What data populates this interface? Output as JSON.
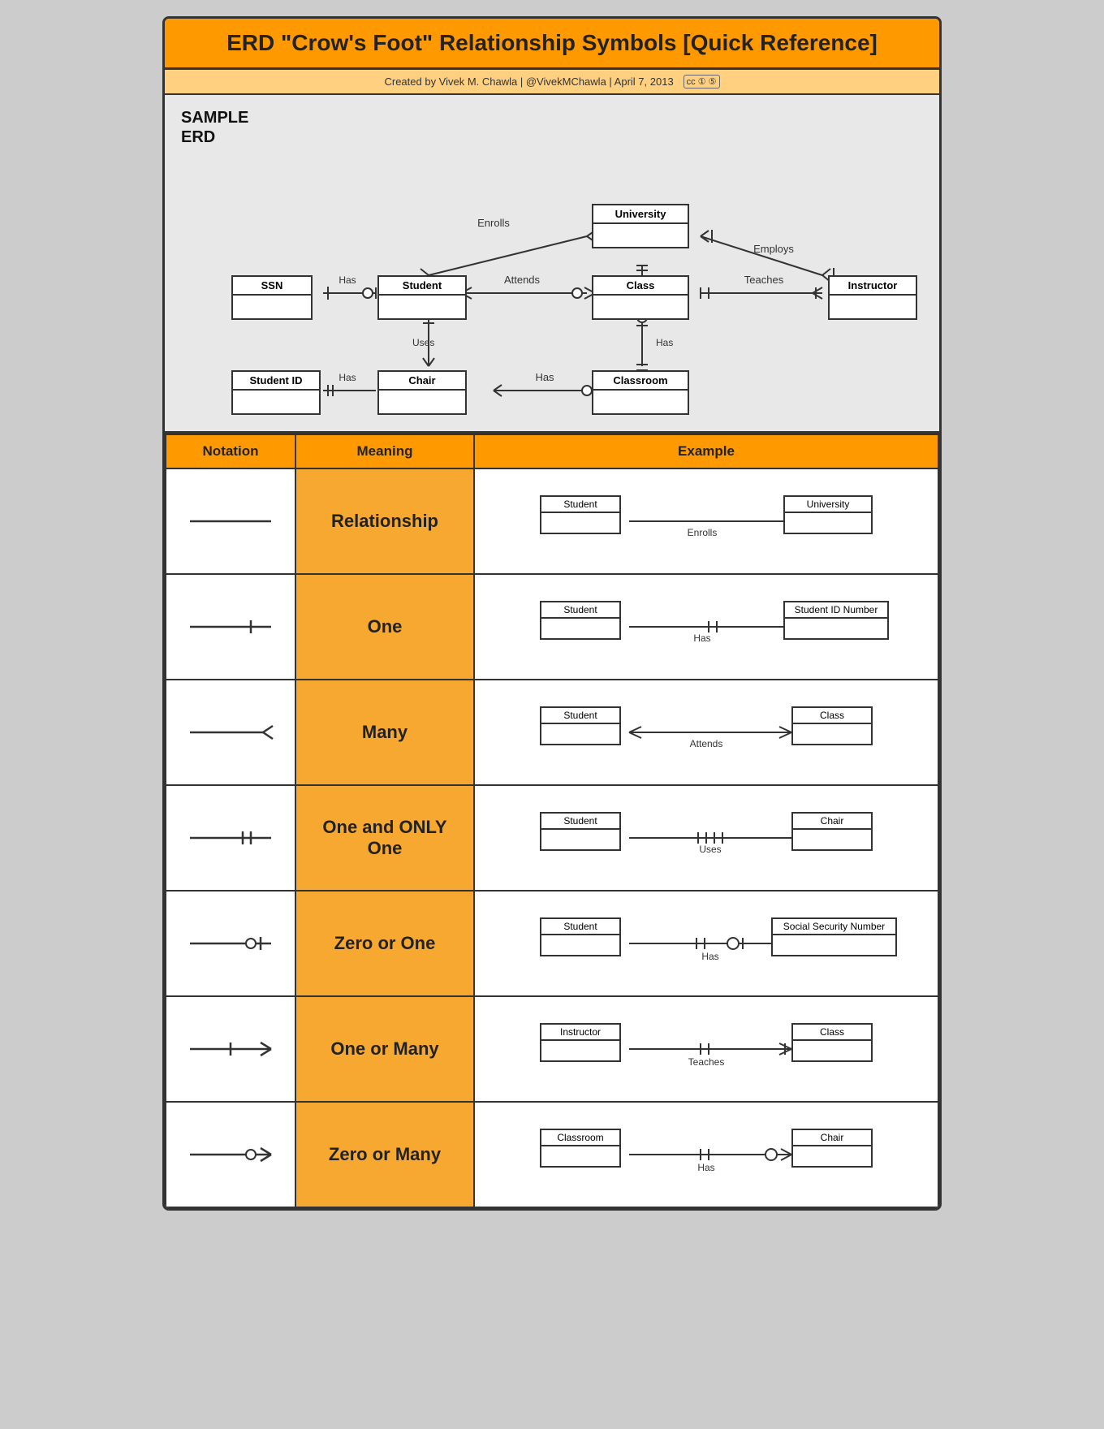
{
  "title": "ERD \"Crow's Foot\" Relationship Symbols [Quick Reference]",
  "subtitle": "Created by Vivek M. Chawla  |  @VivekMChawla  |  April 7, 2013",
  "table": {
    "headers": [
      "Notation",
      "Meaning",
      "Example"
    ],
    "rows": [
      {
        "meaning": "Relationship",
        "ex_left": "Student",
        "ex_right": "University",
        "ex_label": "Enrolls",
        "symbol_type": "line"
      },
      {
        "meaning": "One",
        "ex_left": "Student",
        "ex_right": "Student ID Number",
        "ex_label": "Has",
        "symbol_type": "one"
      },
      {
        "meaning": "Many",
        "ex_left": "Student",
        "ex_right": "Class",
        "ex_label": "Attends",
        "symbol_type": "many"
      },
      {
        "meaning": "One and ONLY One",
        "ex_left": "Student",
        "ex_right": "Chair",
        "ex_label": "Uses",
        "symbol_type": "one-only"
      },
      {
        "meaning": "Zero or One",
        "ex_left": "Student",
        "ex_right": "Social Security Number",
        "ex_label": "Has",
        "symbol_type": "zero-one"
      },
      {
        "meaning": "One or Many",
        "ex_left": "Instructor",
        "ex_right": "Class",
        "ex_label": "Teaches",
        "symbol_type": "one-many"
      },
      {
        "meaning": "Zero or Many",
        "ex_left": "Classroom",
        "ex_right": "Chair",
        "ex_label": "Has",
        "symbol_type": "zero-many"
      }
    ]
  }
}
